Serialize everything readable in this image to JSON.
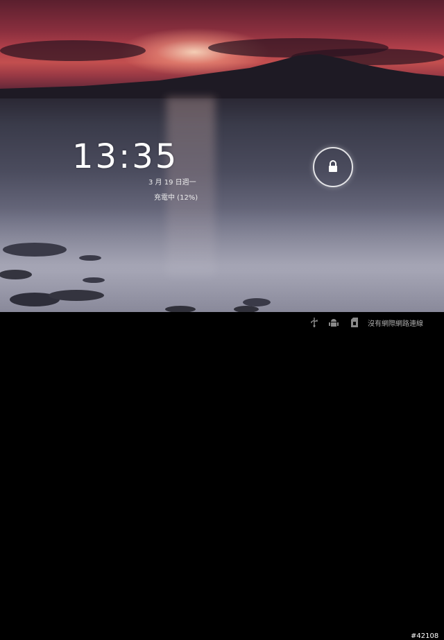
{
  "lockscreen": {
    "time": "13:35",
    "date": "3 月 19 日週一",
    "charging": "充電中 (12%)"
  },
  "statusbar": {
    "network_text": "沒有網際網路連線",
    "icons": [
      "usb-icon",
      "android-debug-icon",
      "sd-card-icon"
    ]
  },
  "watermark": "#42108",
  "colors": {
    "clock": "#ffffff",
    "statusbar_bg": "#000000",
    "lock_ring": "#ffffff"
  }
}
